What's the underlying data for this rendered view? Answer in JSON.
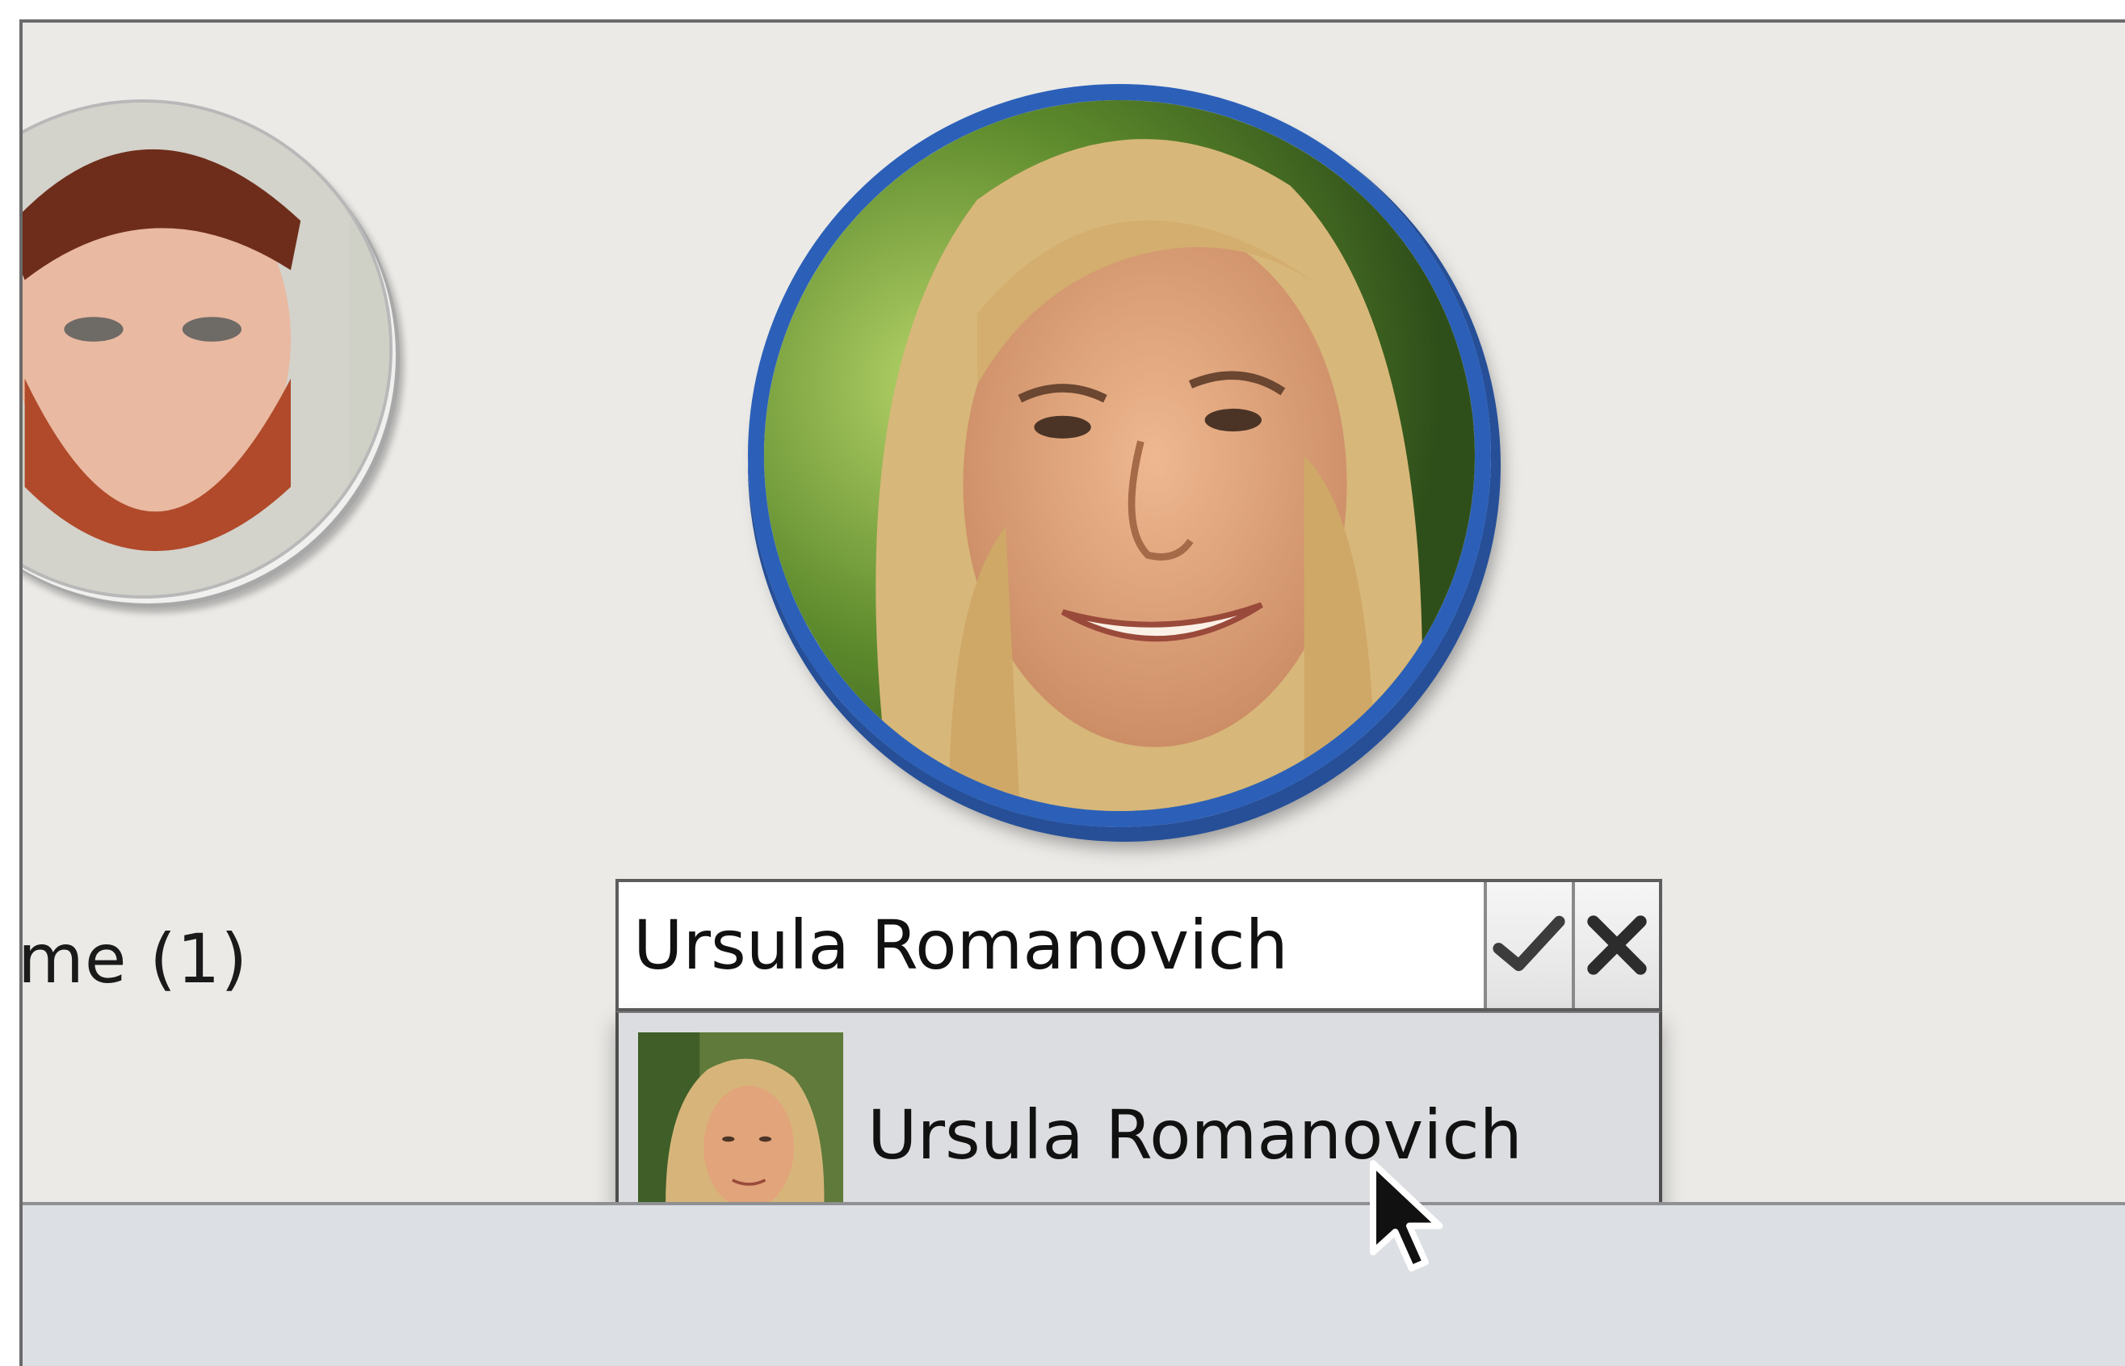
{
  "people": {
    "left_person": {
      "name_label": "me (1)"
    },
    "selected_person": {
      "editor": {
        "value": "Ursula Romanovich",
        "confirm_icon": "checkmark-icon",
        "cancel_icon": "close-icon"
      },
      "suggestions": [
        {
          "name": "Ursula Romanovich"
        }
      ]
    }
  },
  "colors": {
    "selection_ring": "#2c60b8",
    "background": "#ebeae7",
    "bottom_bar": "#dcdfe3"
  }
}
